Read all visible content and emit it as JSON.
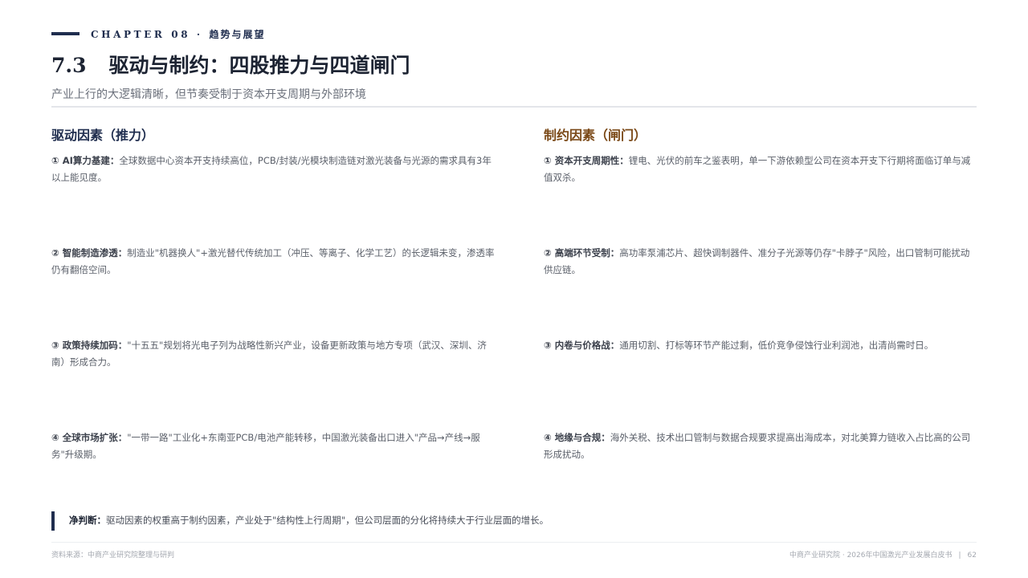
{
  "header": {
    "chapter_label": "CHAPTER 08 ·",
    "chapter_title": "趋势与展望",
    "section_number": "7.3",
    "section_title": "驱动与制约：四股推力与四道闸门",
    "subtitle": "产业上行的大逻辑清晰，但节奏受制于资本开支周期与外部环境"
  },
  "drivers": {
    "heading": "驱动因素（推力）",
    "items": [
      {
        "lead": "① AI算力基建：",
        "text": "全球数据中心资本开支持续高位，PCB/封装/光模块制造链对激光装备与光源的需求具有3年以上能见度。"
      },
      {
        "lead": "② 智能制造渗透：",
        "text": "制造业\"机器换人\"+激光替代传统加工（冲压、等离子、化学工艺）的长逻辑未变，渗透率仍有翻倍空间。"
      },
      {
        "lead": "③ 政策持续加码：",
        "text": "\"十五五\"规划将光电子列为战略性新兴产业，设备更新政策与地方专项（武汉、深圳、济南）形成合力。"
      },
      {
        "lead": "④ 全球市场扩张：",
        "text": "\"一带一路\"工业化+东南亚PCB/电池产能转移，中国激光装备出口进入\"产品→产线→服务\"升级期。"
      }
    ]
  },
  "constraints": {
    "heading": "制约因素（闸门）",
    "items": [
      {
        "lead": "① 资本开支周期性：",
        "text": "锂电、光伏的前车之鉴表明，单一下游依赖型公司在资本开支下行期将面临订单与减值双杀。"
      },
      {
        "lead": "② 高端环节受制：",
        "text": "高功率泵浦芯片、超快调制器件、准分子光源等仍存\"卡脖子\"风险，出口管制可能扰动供应链。"
      },
      {
        "lead": "③ 内卷与价格战：",
        "text": "通用切割、打标等环节产能过剩，低价竞争侵蚀行业利润池，出清尚需时日。"
      },
      {
        "lead": "④ 地缘与合规：",
        "text": "海外关税、技术出口管制与数据合规要求提高出海成本，对北美算力链收入占比高的公司形成扰动。"
      }
    ]
  },
  "net_judgment": {
    "lead": "净判断：",
    "text": "驱动因素的权重高于制约因素，产业处于\"结构性上行周期\"，但公司层面的分化将持续大于行业层面的增长。"
  },
  "footer": {
    "source": "资料来源：中商产业研究院整理与研判",
    "publication": "中商产业研究院 · 2026年中国激光产业发展白皮书",
    "separator": "|",
    "page_number": "62"
  }
}
